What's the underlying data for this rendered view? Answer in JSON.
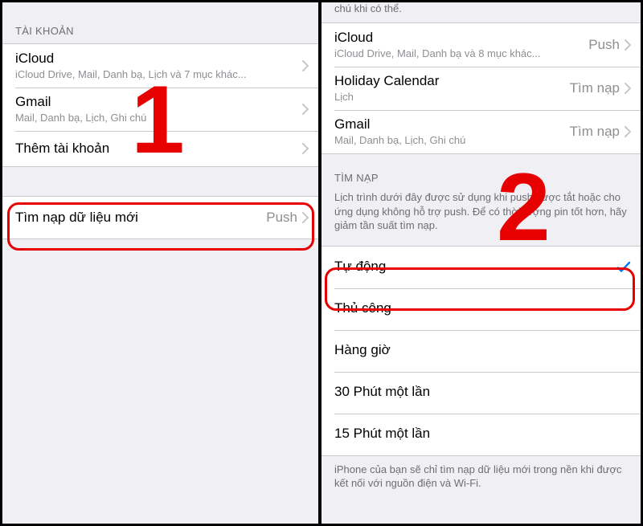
{
  "left": {
    "accounts_header": "TÀI KHOẢN",
    "accounts": [
      {
        "title": "iCloud",
        "sub": "iCloud Drive, Mail, Danh bạ, Lịch và 7 mục khác..."
      },
      {
        "title": "Gmail",
        "sub": "Mail, Danh bạ, Lịch, Ghi chú"
      },
      {
        "title": "Thêm tài khoản",
        "sub": ""
      }
    ],
    "fetch_row": {
      "title": "Tìm nạp dữ liệu mới",
      "value": "Push"
    },
    "annotation": "1"
  },
  "right": {
    "top_cut_text": "chú khi có thể.",
    "accounts": [
      {
        "title": "iCloud",
        "sub": "iCloud Drive, Mail, Danh bạ và 8 mục khác...",
        "value": "Push"
      },
      {
        "title": "Holiday Calendar",
        "sub": "Lịch",
        "value": "Tìm nạp"
      },
      {
        "title": "Gmail",
        "sub": "Mail, Danh bạ, Lịch, Ghi chú",
        "value": "Tìm nạp"
      }
    ],
    "fetch_header": "TÌM NẠP",
    "fetch_desc": "Lịch trình dưới đây được sử dụng khi push được tắt hoặc cho ứng dụng không hỗ trợ push. Để có thời lượng pin tốt hơn, hãy giảm tần suất tìm nạp.",
    "options": [
      {
        "label": "Tự động",
        "checked": true
      },
      {
        "label": "Thủ công",
        "checked": false
      },
      {
        "label": "Hàng giờ",
        "checked": false
      },
      {
        "label": "30 Phút một lần",
        "checked": false
      },
      {
        "label": "15 Phút một lần",
        "checked": false
      }
    ],
    "bottom_note": "iPhone của bạn sẽ chỉ tìm nạp dữ liệu mới trong nền khi được kết nối với nguồn điện và Wi-Fi.",
    "annotation": "2"
  }
}
